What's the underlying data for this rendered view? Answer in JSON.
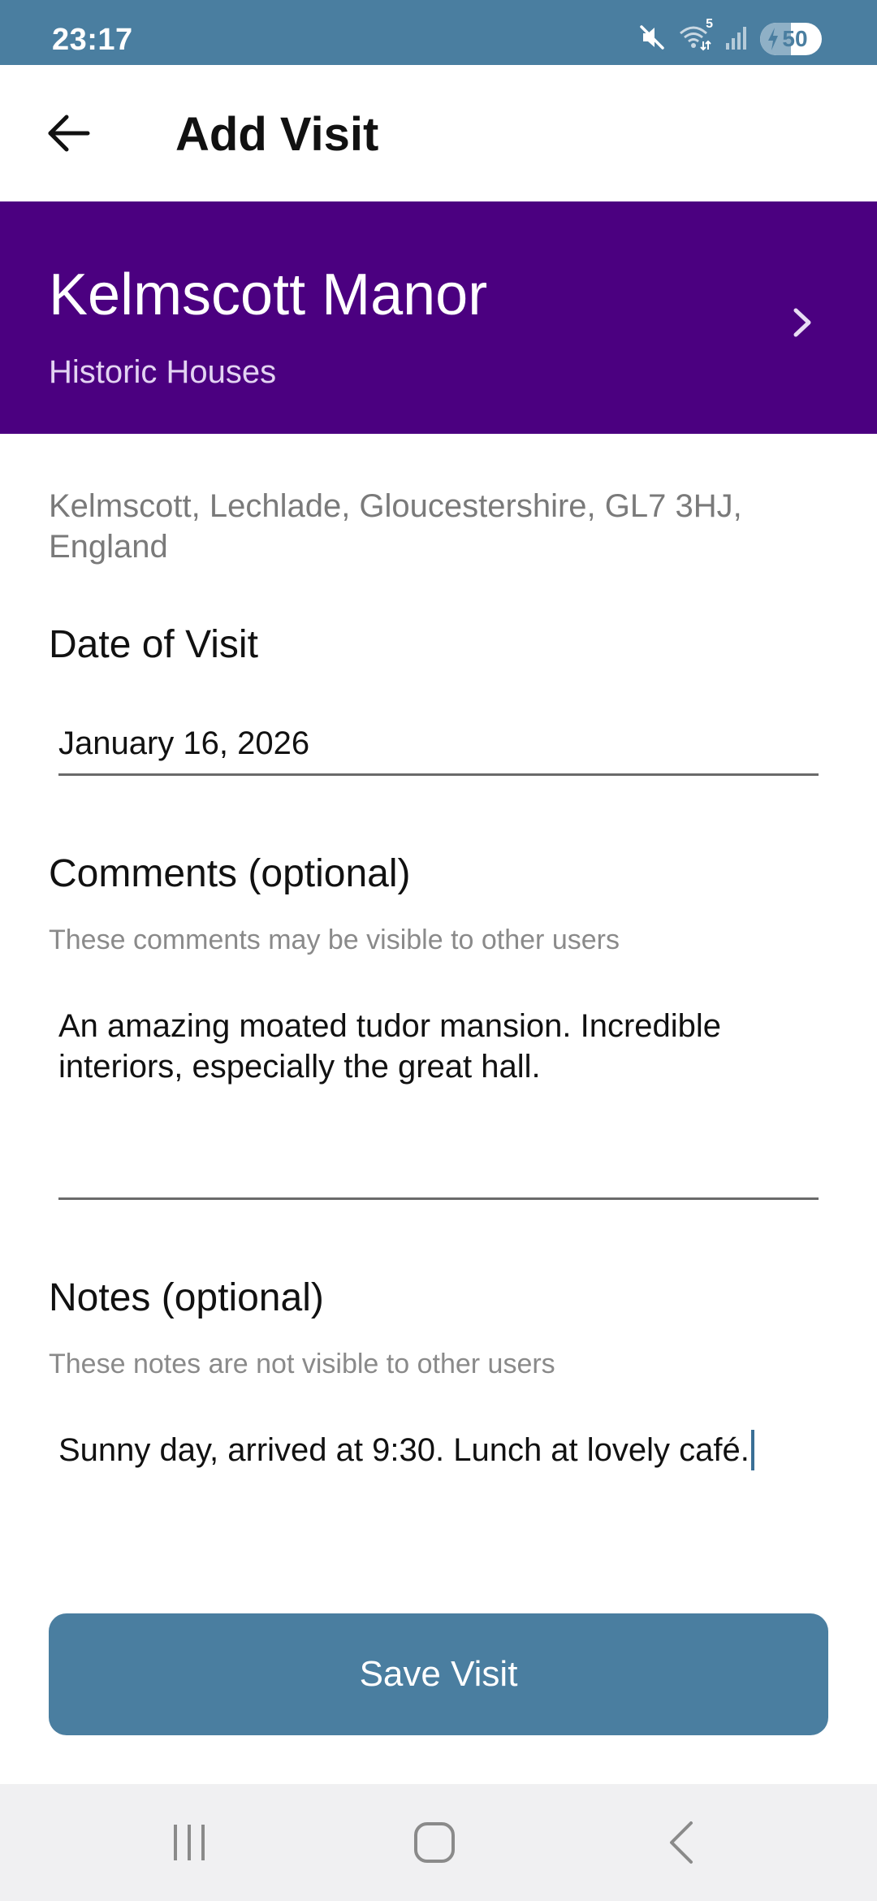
{
  "status_bar": {
    "time": "23:17",
    "battery_level": "50",
    "battery_fill_fraction": 0.5,
    "icons": [
      "mute-icon",
      "wifi-icon",
      "signal-icon",
      "battery-charging-icon"
    ],
    "wifi_badge": "5"
  },
  "app_bar": {
    "title": "Add Visit",
    "back_icon": "arrow-left-icon"
  },
  "place": {
    "name": "Kelmscott Manor",
    "category": "Historic Houses",
    "address": "Kelmscott, Lechlade, Gloucestershire, GL7 3HJ, England",
    "chevron_icon": "chevron-right-icon"
  },
  "form": {
    "date": {
      "label": "Date of Visit",
      "value": "January 16, 2026"
    },
    "comments": {
      "label": "Comments (optional)",
      "help": "These comments may be visible to other users",
      "value": "An amazing moated tudor mansion. Incredible interiors, especially the great hall."
    },
    "notes": {
      "label": "Notes (optional)",
      "help": "These notes are not visible to other users",
      "value": "Sunny day, arrived at 9:30. Lunch at lovely café."
    }
  },
  "actions": {
    "save_label": "Save Visit"
  },
  "nav": {
    "recents_icon": "recents-icon",
    "home_icon": "home-icon",
    "back_icon": "nav-back-icon"
  },
  "colors": {
    "status_bar": "#4a7ea0",
    "hero_background": "#4b0080",
    "primary_button": "#4a7ea0",
    "nav_bar": "#f0f0f2"
  }
}
